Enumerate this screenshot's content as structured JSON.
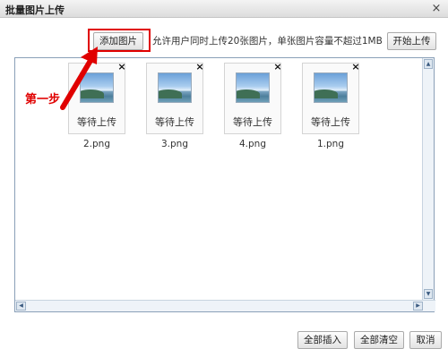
{
  "window": {
    "title": "批量图片上传",
    "close_icon": "×"
  },
  "toolbar": {
    "add_label": "添加图片",
    "limit_text": "允许用户同时上传20张图片，单张图片容量不超过1MB",
    "start_label": "开始上传"
  },
  "annotation": {
    "step_label": "第一步",
    "color": "#e00000"
  },
  "files": [
    {
      "name": "2.png",
      "status": "等待上传"
    },
    {
      "name": "3.png",
      "status": "等待上传"
    },
    {
      "name": "4.png",
      "status": "等待上传"
    },
    {
      "name": "1.png",
      "status": "等待上传"
    }
  ],
  "footer": {
    "insert_all_label": "全部插入",
    "clear_all_label": "全部清空",
    "cancel_label": "取消"
  },
  "icons": {
    "remove": "×",
    "scroll_up": "▲",
    "scroll_down": "▼",
    "scroll_left": "◀",
    "scroll_right": "▶"
  }
}
